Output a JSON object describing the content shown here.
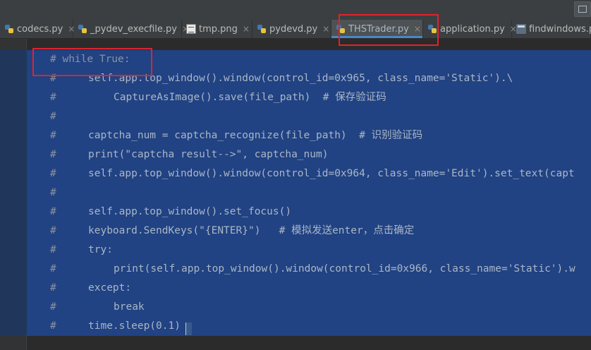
{
  "tabs": [
    {
      "label": "codecs.py",
      "icon": "python-file-icon"
    },
    {
      "label": "_pydev_execfile.py",
      "icon": "python-file-icon"
    },
    {
      "label": "tmp.png",
      "icon": "image-file-icon"
    },
    {
      "label": "pydevd.py",
      "icon": "python-file-icon"
    },
    {
      "label": "THSTrader.py",
      "icon": "python-file-icon",
      "active": true
    },
    {
      "label": "application.py",
      "icon": "python-file-icon"
    },
    {
      "label": "findwindows.p",
      "icon": "window-file-icon"
    }
  ],
  "tab_close_glyph": "×",
  "editor": {
    "comment_marker": "#",
    "lines": [
      "# while True:",
      "self.app.top_window().window(control_id=0x965, class_name='Static').\\",
      "CaptureAsImage().save(file_path)  # 保存验证码",
      "",
      "captcha_num = captcha_recognize(file_path)  # 识别验证码",
      "print(\"captcha result-->\", captcha_num)",
      "self.app.top_window().window(control_id=0x964, class_name='Edit').set_text(capt",
      "",
      "self.app.top_window().set_focus()",
      "keyboard.SendKeys(\"{ENTER}\")   # 模拟发送enter，点击确定",
      "try:",
      "print(self.app.top_window().window(control_id=0x966, class_name='Static').w",
      "except:",
      "break",
      "time.sleep(0.1)"
    ]
  },
  "colors": {
    "background": "#2b2b2b",
    "selection": "#214283",
    "tab_active_underline": "#4a88c7",
    "annotation_box": "#e0232b",
    "code_text": "#a9b7c6"
  }
}
